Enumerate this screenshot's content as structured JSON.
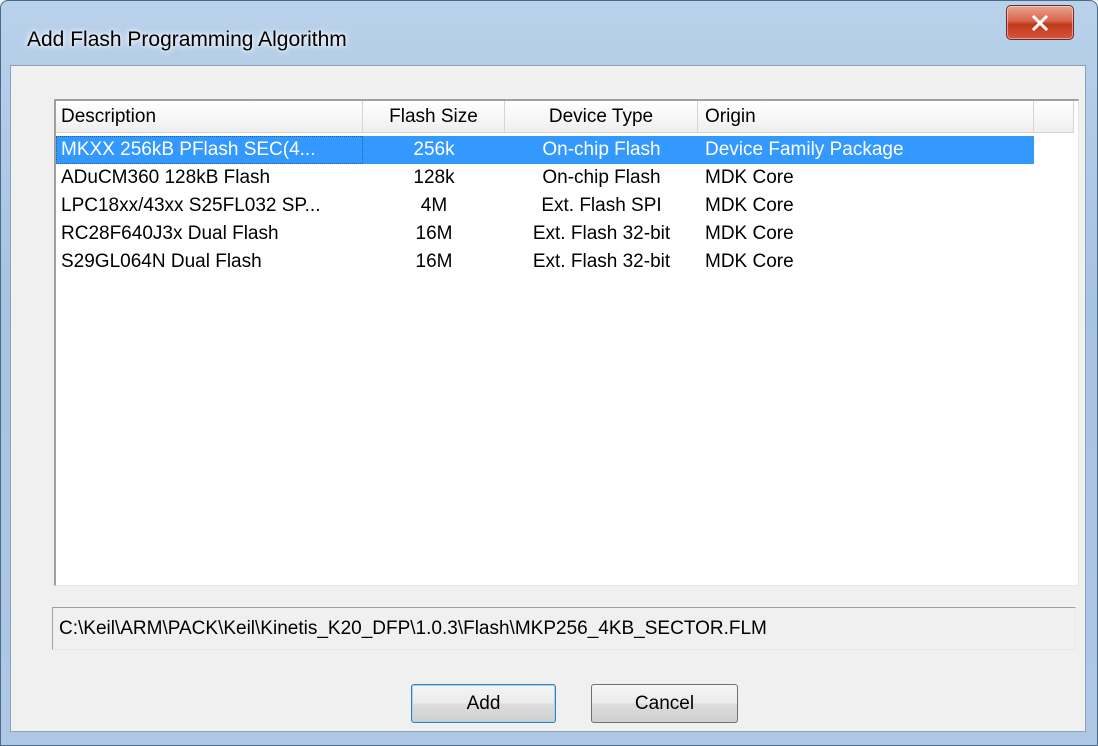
{
  "window": {
    "title": "Add Flash Programming Algorithm",
    "close_glyph": "✕"
  },
  "table": {
    "columns": [
      "Description",
      "Flash Size",
      "Device Type",
      "Origin"
    ],
    "rows": [
      [
        "MKXX 256kB PFlash SEC(4...",
        "256k",
        "On-chip Flash",
        "Device Family Package"
      ],
      [
        "ADuCM360 128kB Flash",
        "128k",
        "On-chip Flash",
        "MDK Core"
      ],
      [
        "LPC18xx/43xx S25FL032 SP...",
        "4M",
        "Ext. Flash SPI",
        "MDK Core"
      ],
      [
        "RC28F640J3x Dual Flash",
        "16M",
        "Ext. Flash 32-bit",
        "MDK Core"
      ],
      [
        "S29GL064N Dual Flash",
        "16M",
        "Ext. Flash 32-bit",
        "MDK Core"
      ]
    ],
    "selected_index": 0
  },
  "path": "C:\\Keil\\ARM\\PACK\\Keil\\Kinetis_K20_DFP\\1.0.3\\Flash\\MKP256_4KB_SECTOR.FLM",
  "buttons": {
    "add": "Add",
    "cancel": "Cancel"
  },
  "colors": {
    "selection": "#3399ff",
    "close_button": "#c2381d"
  },
  "icons": {
    "close": "close-icon"
  }
}
